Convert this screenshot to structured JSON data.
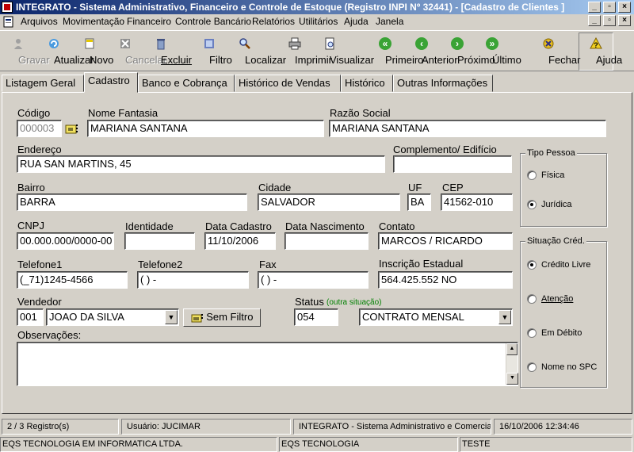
{
  "window": {
    "title": "INTEGRATO - Sistema Administrativo, Financeiro e Controle de Estoque (Registro INPI Nº 32441) - [Cadastro de Clientes ]"
  },
  "menu": [
    "Arquivos",
    "Movimentação",
    "Financeiro",
    "Controle Bancário",
    "Relatórios",
    "Utilitários",
    "Ajuda",
    "Janela"
  ],
  "toolbar": {
    "gravar": "Gravar",
    "atualizar": "Atualizar",
    "novo": "Novo",
    "cancelar": "Cancelar",
    "excluir": "Excluir",
    "filtro": "Filtro",
    "localizar": "Localizar",
    "imprimir": "Imprimir",
    "visualizar": "Visualizar",
    "primeiro": "Primeiro",
    "anterior": "Anterior",
    "proximo": "Próximo",
    "ultimo": "Último",
    "fechar": "Fechar",
    "ajuda": "Ajuda"
  },
  "tabs": [
    "Listagem Geral",
    "Cadastro",
    "Banco e Cobrança",
    "Histórico de Vendas",
    "Histórico",
    "Outras Informações"
  ],
  "form": {
    "codigo_label": "Código",
    "codigo": "000003",
    "nome_fantasia_label": "Nome Fantasia",
    "nome_fantasia": "MARIANA SANTANA",
    "razao_social_label": "Razão Social",
    "razao_social": "MARIANA SANTANA",
    "endereco_label": "Endereço",
    "endereco": "RUA SAN MARTINS, 45",
    "complemento_label": "Complemento/ Edifício",
    "complemento": "",
    "bairro_label": "Bairro",
    "bairro": "BARRA",
    "cidade_label": "Cidade",
    "cidade": "SALVADOR",
    "uf_label": "UF",
    "uf": "BA",
    "cep_label": "CEP",
    "cep": "41562-010",
    "cnpj_label": "CNPJ",
    "cnpj": "00.000.000/0000-00",
    "identidade_label": "Identidade",
    "identidade": "",
    "data_cadastro_label": "Data Cadastro",
    "data_cadastro": "11/10/2006",
    "data_nascimento_label": "Data Nascimento",
    "data_nascimento": "",
    "contato_label": "Contato",
    "contato": "MARCOS / RICARDO",
    "telefone1_label": "Telefone1",
    "telefone1": "(_71)1245-4566",
    "telefone2_label": "Telefone2",
    "telefone2": "(  )   -",
    "fax_label": "Fax",
    "fax": "(  )   -",
    "inscricao_label": "Inscrição Estadual",
    "inscricao": "564.425.552 NO",
    "vendedor_label": "Vendedor",
    "vendedor_codigo": "001",
    "vendedor_nome": "JOAO DA SILVA",
    "sem_filtro": "Sem Filtro",
    "status_label": "Status",
    "status_hint": "(outra situação)",
    "status_codigo": "054",
    "status_nome": "CONTRATO MENSAL",
    "observacoes_label": "Observações:",
    "observacoes": ""
  },
  "tipo_pessoa": {
    "title": "Tipo Pessoa",
    "fisica": "Física",
    "juridica": "Jurídica",
    "selected": "Jurídica"
  },
  "situacao_cred": {
    "title": "Situação Créd.",
    "options": [
      "Crédito Livre",
      "Atenção",
      "Em Débito",
      "Nome no SPC"
    ],
    "selected": "Crédito Livre"
  },
  "statusbar": {
    "registros": "2 / 3 Registro(s)",
    "usuario": "Usuário: JUCIMAR",
    "sistema": "INTEGRATO - Sistema Administrativo e Comercial",
    "datahora": "16/10/2006 12:34:46",
    "empresa": "EQS TECNOLOGIA EM INFORMATICA LTDA.",
    "empresa2": "EQS TECNOLOGIA",
    "teste": "TESTE"
  },
  "colors": {
    "title_start": "#0a246a",
    "title_end": "#a6caf0",
    "status_hint": "#008000",
    "face": "#d4d0c8"
  }
}
